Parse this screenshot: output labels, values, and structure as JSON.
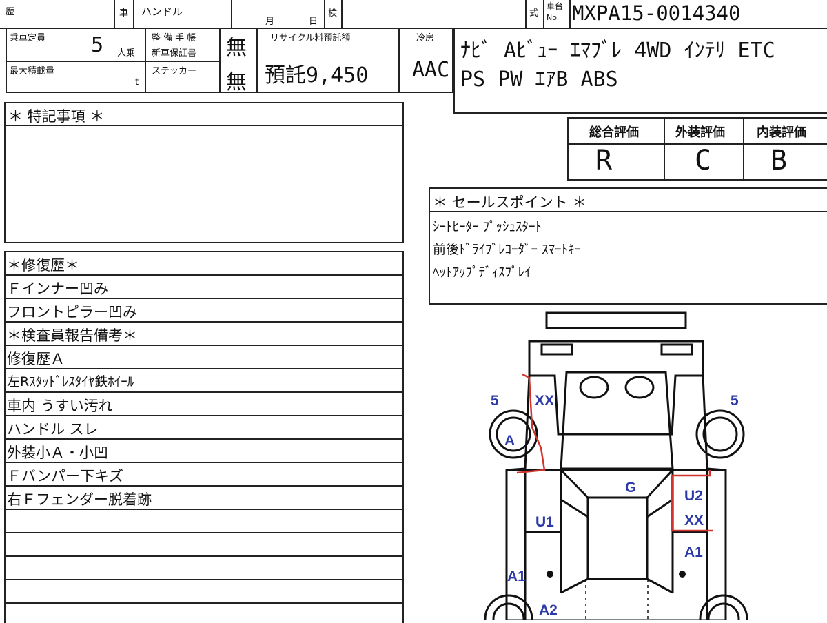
{
  "header": {
    "reki": "歴",
    "sha": "車",
    "handle": "ハンドル",
    "month": "月",
    "day": "日",
    "ken": "検",
    "shiki": "式",
    "chassis_label_1": "車台",
    "chassis_label_2": "No.",
    "chassis_no": "MXPA15-0014340"
  },
  "specs": {
    "capacity_label": "乗車定員",
    "capacity_value": "5",
    "capacity_unit": "人乗",
    "max_load_label": "最大積載量",
    "max_load_unit": "t",
    "maintenance_label_1": "整 備 手 帳",
    "maintenance_label_2": "新車保証書",
    "maintenance_value": "無",
    "sticker_label": "ステッカー",
    "sticker_value": "無",
    "recycle_label": "リサイクル料預託額",
    "recycle_value": "預託9,450",
    "aircon_label": "冷房",
    "aircon_value": "AAC",
    "equipment_line1": "ﾅﾋﾞ  Aﾋﾞｭｰ ｴﾏﾌﾞﾚ 4WD ｲﾝﾃﾘ ETC",
    "equipment_line2": "PS PW ｴｱB ABS"
  },
  "ratings": {
    "overall_label": "総合評価",
    "overall_value": "R",
    "exterior_label": "外装評価",
    "exterior_value": "C",
    "interior_label": "内装評価",
    "interior_value": "B"
  },
  "special_notes": {
    "title": "＊ 特記事項 ＊"
  },
  "sales_points": {
    "title": "＊ セールスポイント ＊",
    "lines": [
      "ｼｰﾄﾋｰﾀｰ  ﾌﾟｯｼｭｽﾀｰﾄ",
      "前後ﾄﾞﾗｲﾌﾞﾚｺｰﾀﾞｰ  ｽﾏｰﾄｷｰ",
      "ﾍｯﾄｱｯﾌﾟﾃﾞｨｽﾌﾟﾚｲ"
    ]
  },
  "repair": {
    "rows": [
      "＊修復歴＊",
      "Ｆインナー凹み",
      "フロントピラー凹み",
      "＊検査員報告備考＊",
      "修復歴Ａ",
      "左Rｽﾀｯﾄﾞﾚｽﾀｲﾔ鉄ﾎｲｰﾙ",
      "車内 うすい汚れ",
      "ハンドル スレ",
      "外装小Ａ・小凹",
      "Ｆバンパー下キズ",
      "右Ｆフェンダー脱着跡",
      "",
      "",
      "",
      "",
      ""
    ]
  },
  "diagram": {
    "marks": {
      "left_front_num": "5",
      "right_front_num": "5",
      "left_fender": "XX",
      "left_tire": "A",
      "hood": "G",
      "left_pillar": "U1",
      "right_pillar": "U2",
      "right_fender": "XX",
      "right_door": "A1",
      "left_door": "A1",
      "left_rear_door": "A2"
    },
    "colors": {
      "marks": "#2b3aa8",
      "repair_outline": "#d0342c"
    }
  }
}
